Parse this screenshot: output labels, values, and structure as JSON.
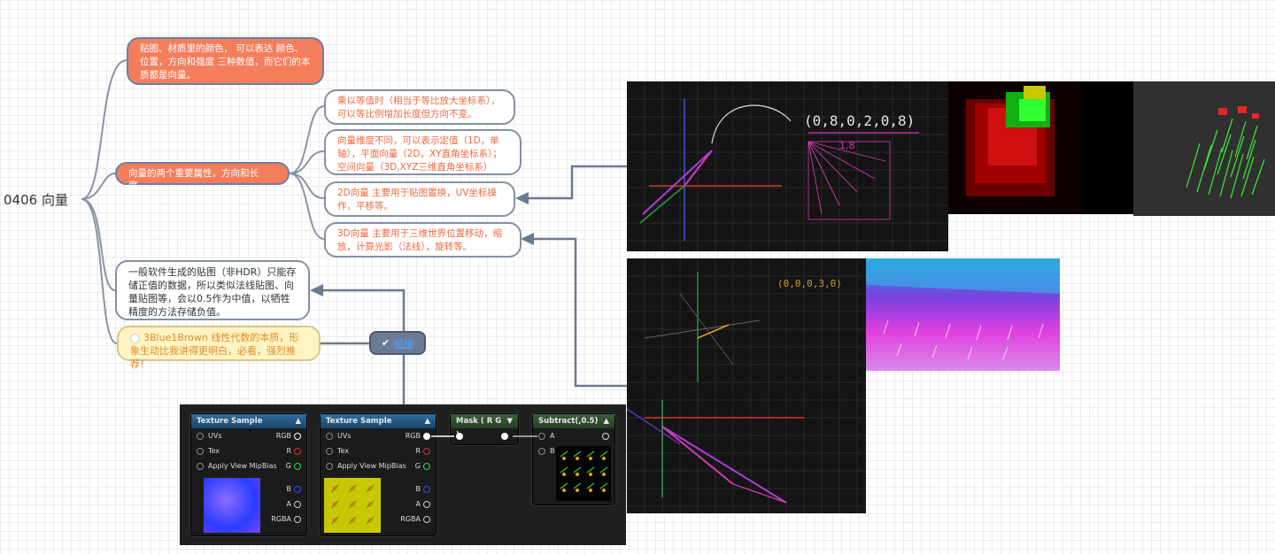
{
  "mindmap": {
    "root": "0406 向量",
    "nodes": {
      "texture_vector": "贴图、材质里的颜色， 可以表达 颜色、位置，方向和强度 三种数值，而它们的本质都是向量。",
      "two_attributes": "向量的两个重要属性，方向和长度。",
      "scale": "乘以等值时（相当于等比放大坐标系），可以等比例增加长度但方向不变。",
      "dimensions": "向量维度不同，可以表示定值（1D，单轴），平面向量（2D，XY直角坐标系）；空间向量（3D,XYZ三维直角坐标系）",
      "vec2d": "2D向量 主要用于贴图置换，UV坐标操作，平移等。",
      "vec3d": "3D向量 主要用于三维世界位置移动，缩放，计算光影（法线），旋转等。",
      "hdr": "一般软件生成的贴图（非HDR）只能存储正值的数据，所以类似法线贴图、向量贴图等，会以0.5作为中值，以牺牲精度的方法存储负值。",
      "recommend": "3Blue1Brown 线性代数的本质，形象生动比我讲得更明白，必看，强烈推荐！"
    },
    "tag_label": "链接"
  },
  "sketch": {
    "top_coords": "(0,8,0,2,0,8)",
    "top_sub": "1,8",
    "mid_coords": "(0,0,0,3,0)"
  },
  "node_graph": {
    "nodes": [
      {
        "title": "Texture Sample",
        "inputs": [
          "UVs",
          "Tex",
          "Apply View MipBias"
        ],
        "outputs": [
          "RGB",
          "R",
          "G",
          "B",
          "A",
          "RGBA"
        ],
        "preview": "normal-map"
      },
      {
        "title": "Texture Sample",
        "inputs": [
          "UVs",
          "Tex",
          "Apply View MipBias"
        ],
        "outputs": [
          "RGB",
          "R",
          "G",
          "B",
          "A",
          "RGBA"
        ],
        "preview": "vector-map"
      },
      {
        "title": "Mask ( R G )",
        "inputs": [],
        "outputs": []
      },
      {
        "title": "Subtract(,0.5)",
        "inputs": [
          "A",
          "B"
        ],
        "outputs": [],
        "preview": "arrow-field"
      }
    ]
  },
  "colors": {
    "orange_node": "#f47e5c",
    "node_border": "#6b7fa3",
    "link_color": "#6b7a8f",
    "recommend_bg": "#fff4c2"
  }
}
